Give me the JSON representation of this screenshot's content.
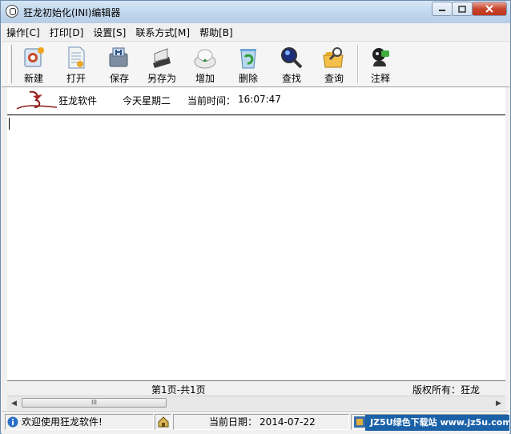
{
  "window": {
    "title": "狂龙初始化(INI)编辑器"
  },
  "menu": [
    {
      "label": "操作[C]"
    },
    {
      "label": "打印[D]"
    },
    {
      "label": "设置[S]"
    },
    {
      "label": "联系方式[M]"
    },
    {
      "label": "帮助[B]"
    }
  ],
  "toolbar": [
    {
      "label": "新建",
      "icon": "new-file-icon"
    },
    {
      "label": "打开",
      "icon": "open-document-icon"
    },
    {
      "label": "保存",
      "icon": "save-disk-icon"
    },
    {
      "label": "另存为",
      "icon": "save-as-icon"
    },
    {
      "label": "增加",
      "icon": "add-icon"
    },
    {
      "label": "删除",
      "icon": "recycle-bin-icon"
    },
    {
      "label": "查找",
      "icon": "magnifier-icon"
    },
    {
      "label": "查询",
      "icon": "query-folder-icon"
    },
    {
      "label": "注释",
      "icon": "comment-icon"
    }
  ],
  "info": {
    "software": "狂龙软件",
    "weekday": "今天星期二",
    "time_label": "当前时间：",
    "time": "16:07:47"
  },
  "pager": {
    "page_text": "第1页-共1页",
    "copyright": "版权所有：狂龙"
  },
  "scrollbar": {
    "thumb_grip": "III"
  },
  "status": {
    "welcome": "欢迎使用狂龙软件!",
    "date_label": "当前日期：",
    "date": "2014-07-22"
  },
  "watermark": {
    "text": "JZ5U绿色下载站 www.jz5u.com"
  }
}
